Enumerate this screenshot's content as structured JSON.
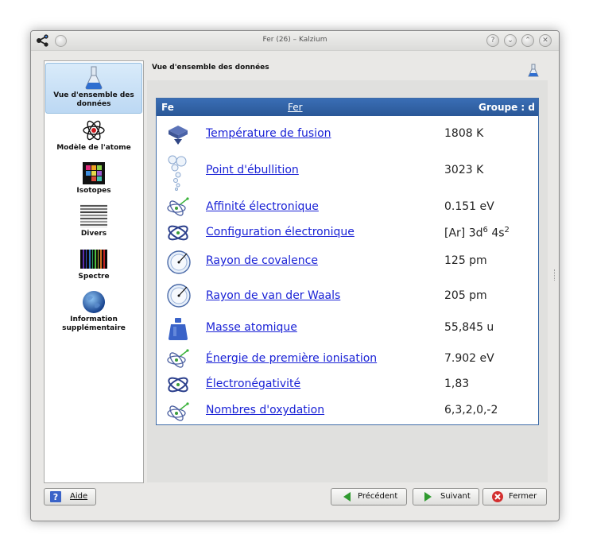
{
  "window": {
    "title": "Fer (26) – Kalzium"
  },
  "sidebar": {
    "items": [
      {
        "label": "Vue d'ensemble des données",
        "icon": "flask-icon"
      },
      {
        "label": "Modèle de l'atome",
        "icon": "atom-icon"
      },
      {
        "label": "Isotopes",
        "icon": "isotopes-grid-icon"
      },
      {
        "label": "Divers",
        "icon": "stripes-icon"
      },
      {
        "label": "Spectre",
        "icon": "spectrum-icon"
      },
      {
        "label": "Information supplémentaire",
        "icon": "globe-icon"
      }
    ]
  },
  "main": {
    "section_title": "Vue d'ensemble des données",
    "header": {
      "symbol": "Fe",
      "name": "Fer",
      "group": "Groupe : d"
    },
    "rows": [
      {
        "label": "Température de fusion",
        "value": "1808 K",
        "icon": "melting-icon"
      },
      {
        "label": "Point d'ébullition",
        "value": "3023 K",
        "icon": "bubbles-icon"
      },
      {
        "label": "Affinité électronique",
        "value": "0.151 eV",
        "icon": "atom-arrow-icon"
      },
      {
        "label": "Configuration électronique",
        "value_prefix": "[Ar] 3d",
        "sup1": "6",
        "value_mid": " 4s",
        "sup2": "2",
        "icon": "orbital-icon"
      },
      {
        "label": "Rayon de covalence",
        "value": "125 pm",
        "icon": "radius-icon"
      },
      {
        "label": "Rayon de van der Waals",
        "value": "205 pm",
        "icon": "radius-icon"
      },
      {
        "label": "Masse atomique",
        "value": "55,845 u",
        "icon": "weight-icon"
      },
      {
        "label": "Énergie de première ionisation",
        "value": "7.902 eV",
        "icon": "atom-arrow-icon"
      },
      {
        "label": "Électronégativité",
        "value": "1,83",
        "icon": "orbital-icon"
      },
      {
        "label": "Nombres d'oxydation",
        "value": "6,3,2,0,-2",
        "icon": "atom-arrow-icon"
      }
    ]
  },
  "buttons": {
    "help": "Aide",
    "previous": "Précédent",
    "next": "Suivant",
    "close": "Fermer"
  },
  "colors": {
    "header_blue": "#2f60a5",
    "link_blue": "#1a22d6",
    "selection": "#bcd8f3"
  }
}
